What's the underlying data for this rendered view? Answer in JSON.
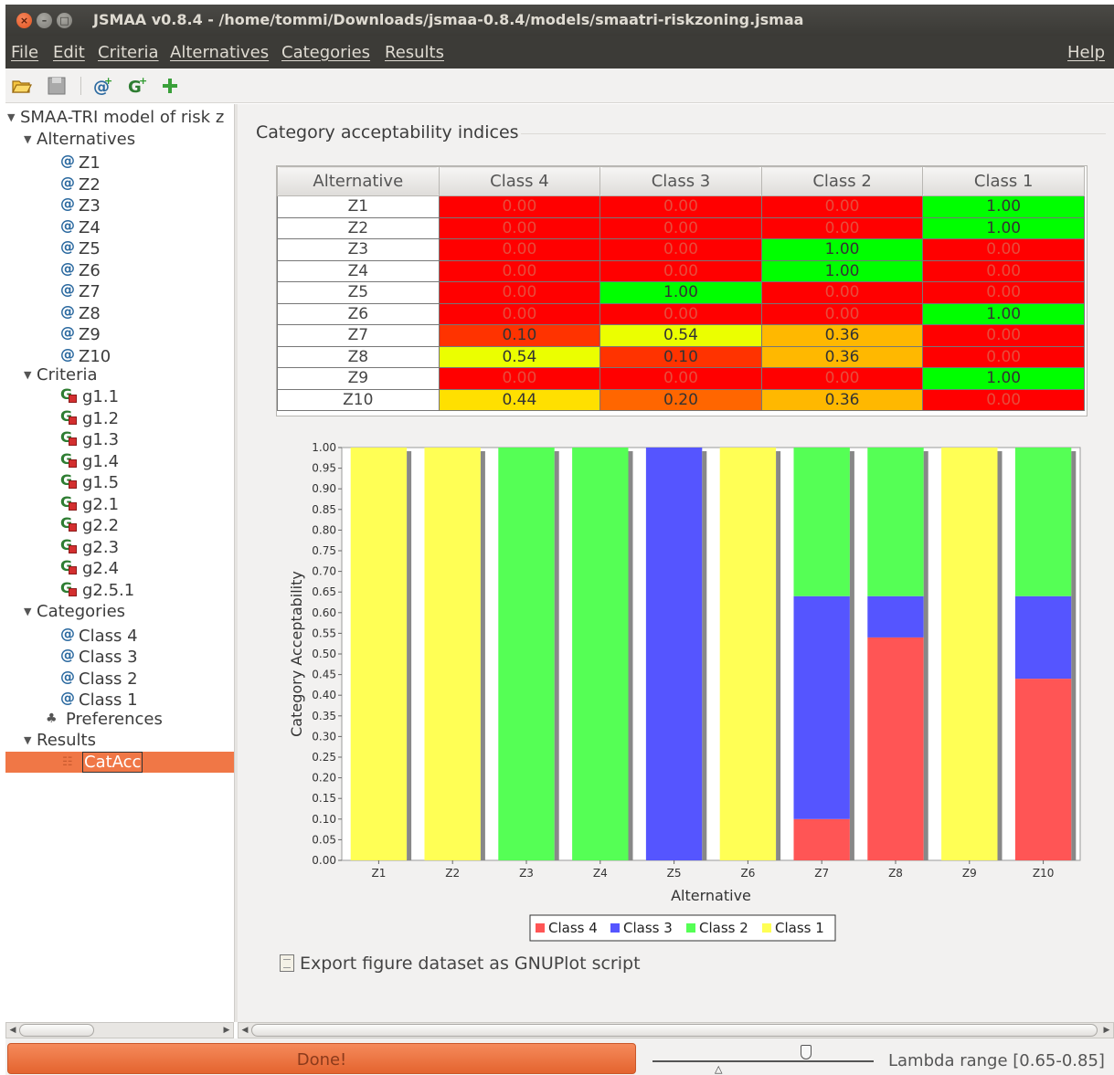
{
  "window": {
    "title": "JSMAA v0.8.4 - /home/tommi/Downloads/jsmaa-0.8.4/models/smaatri-riskzoning.jsmaa",
    "close_glyph": "×",
    "min_glyph": "–",
    "max_glyph": "□"
  },
  "menubar": {
    "items": [
      "File",
      "Edit",
      "Criteria",
      "Alternatives",
      "Categories",
      "Results"
    ],
    "help": "Help"
  },
  "toolbar": {
    "icons": [
      "open-folder-icon",
      "save-icon",
      "add-alternative-icon",
      "add-criterion-icon",
      "add-category-icon"
    ]
  },
  "tree": {
    "root": "SMAA-TRI model of risk z",
    "alternatives_label": "Alternatives",
    "alternatives": [
      "Z1",
      "Z2",
      "Z3",
      "Z4",
      "Z5",
      "Z6",
      "Z7",
      "Z8",
      "Z9",
      "Z10"
    ],
    "criteria_label": "Criteria",
    "criteria": [
      "g1.1",
      "g1.2",
      "g1.3",
      "g1.4",
      "g1.5",
      "g2.1",
      "g2.2",
      "g2.3",
      "g2.4",
      "g2.5.1"
    ],
    "categories_label": "Categories",
    "categories": [
      "Class 4",
      "Class 3",
      "Class 2",
      "Class 1"
    ],
    "preferences": "Preferences",
    "results_label": "Results",
    "results": [
      "CatAcc"
    ]
  },
  "main": {
    "section_title": "Category acceptability indices",
    "table": {
      "headers": [
        "Alternative",
        "Class 4",
        "Class 3",
        "Class 2",
        "Class 1"
      ],
      "rows": [
        {
          "alt": "Z1",
          "values": [
            "0.00",
            "0.00",
            "0.00",
            "1.00"
          ]
        },
        {
          "alt": "Z2",
          "values": [
            "0.00",
            "0.00",
            "0.00",
            "1.00"
          ]
        },
        {
          "alt": "Z3",
          "values": [
            "0.00",
            "0.00",
            "1.00",
            "0.00"
          ]
        },
        {
          "alt": "Z4",
          "values": [
            "0.00",
            "0.00",
            "1.00",
            "0.00"
          ]
        },
        {
          "alt": "Z5",
          "values": [
            "0.00",
            "1.00",
            "0.00",
            "0.00"
          ]
        },
        {
          "alt": "Z6",
          "values": [
            "0.00",
            "0.00",
            "0.00",
            "1.00"
          ]
        },
        {
          "alt": "Z7",
          "values": [
            "0.10",
            "0.54",
            "0.36",
            "0.00"
          ]
        },
        {
          "alt": "Z8",
          "values": [
            "0.54",
            "0.10",
            "0.36",
            "0.00"
          ]
        },
        {
          "alt": "Z9",
          "values": [
            "0.00",
            "0.00",
            "0.00",
            "1.00"
          ]
        },
        {
          "alt": "Z10",
          "values": [
            "0.44",
            "0.20",
            "0.36",
            "0.00"
          ]
        }
      ]
    },
    "export_link": "Export figure dataset as GNUPlot script"
  },
  "chart_data": {
    "type": "bar",
    "stacked": true,
    "categories": [
      "Z1",
      "Z2",
      "Z3",
      "Z4",
      "Z5",
      "Z6",
      "Z7",
      "Z8",
      "Z9",
      "Z10"
    ],
    "series": [
      {
        "name": "Class 4",
        "color": "#ff5555",
        "values": [
          0,
          0,
          0,
          0,
          0,
          0,
          0.1,
          0.54,
          0,
          0.44
        ]
      },
      {
        "name": "Class 3",
        "color": "#5555ff",
        "values": [
          0,
          0,
          0,
          0,
          1,
          0,
          0.54,
          0.1,
          0,
          0.2
        ]
      },
      {
        "name": "Class 2",
        "color": "#55ff55",
        "values": [
          0,
          0,
          1,
          1,
          0,
          0,
          0.36,
          0.36,
          0,
          0.36
        ]
      },
      {
        "name": "Class 1",
        "color": "#ffff55",
        "values": [
          1,
          1,
          0,
          0,
          0,
          1,
          0,
          0,
          1,
          0
        ]
      }
    ],
    "xlabel": "Alternative",
    "ylabel": "Category Acceptability",
    "ylim": [
      0,
      1
    ],
    "yticks": [
      "0.00",
      "0.05",
      "0.10",
      "0.15",
      "0.20",
      "0.25",
      "0.30",
      "0.35",
      "0.40",
      "0.45",
      "0.50",
      "0.55",
      "0.60",
      "0.65",
      "0.70",
      "0.75",
      "0.80",
      "0.85",
      "0.90",
      "0.95",
      "1.00"
    ],
    "grid": false,
    "legend": "bottom-center"
  },
  "status": {
    "progress_label": "Done!",
    "progress_fraction": 1,
    "lambda_text": "Lambda range [0.65-0.85]",
    "lambda_range": [
      0.65,
      0.85
    ]
  },
  "colors": {
    "title_bg": "#3c3b37",
    "selection": "#f07746",
    "acc_zero": "#ff0000",
    "acc_one": "#00ff00"
  }
}
